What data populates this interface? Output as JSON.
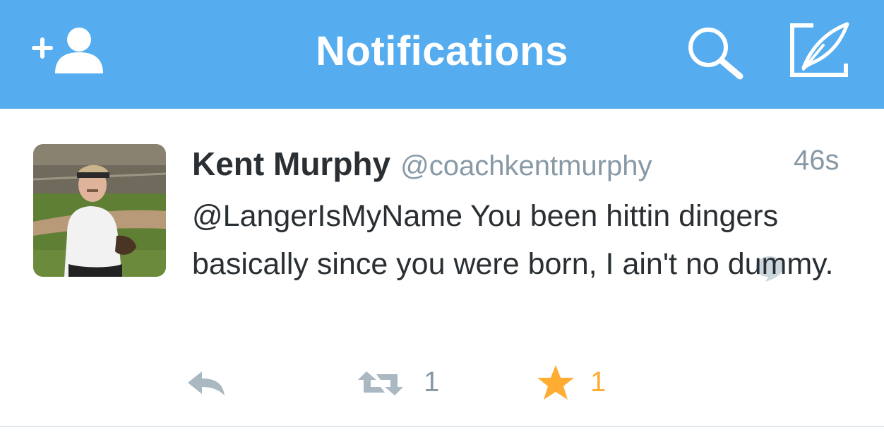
{
  "nav": {
    "title": "Notifications",
    "icons": [
      "add-user-icon",
      "search-icon",
      "compose-icon"
    ],
    "background_color": "#55ACEE"
  },
  "tweet": {
    "display_name": "Kent Murphy",
    "handle": "@coachkentmurphy",
    "timestamp": "46s",
    "text": "@LangerIsMyName You been hittin dingers basically since you were born, I ain't no dummy.",
    "retweet_count": "1",
    "favorite_count": "1",
    "icons": [
      "conversation-icon",
      "reply-icon",
      "retweet-icon",
      "star-icon"
    ],
    "colors": {
      "text": "#292F33",
      "secondary": "#8899A6",
      "favorite": "#FFAC33"
    }
  }
}
